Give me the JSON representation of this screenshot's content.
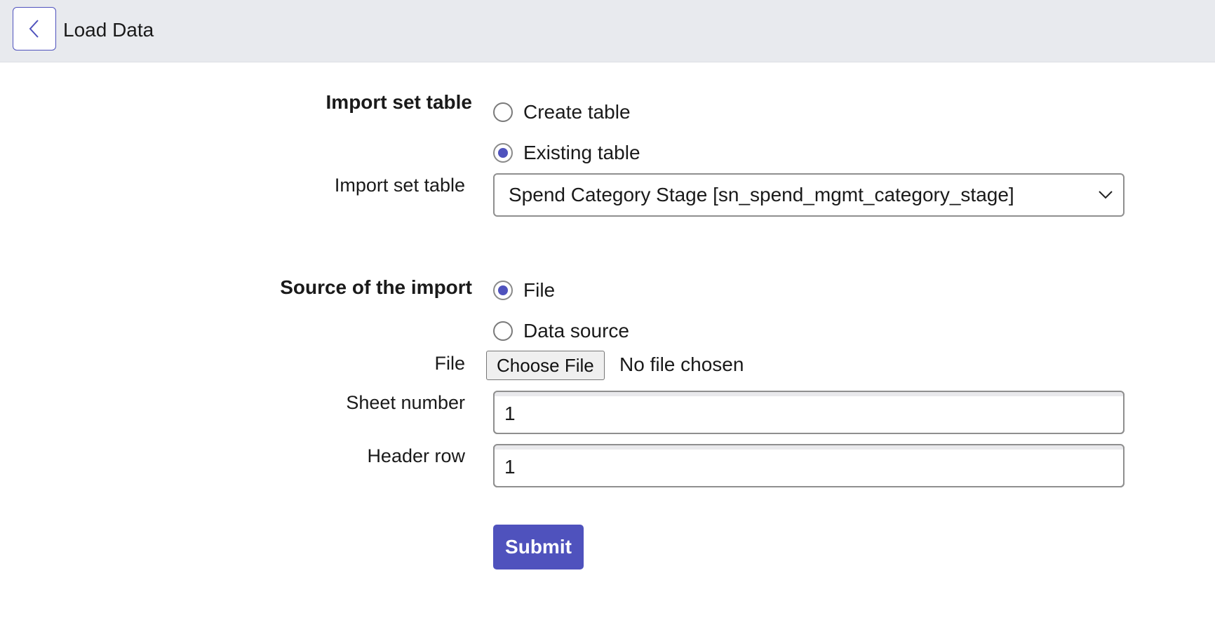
{
  "header": {
    "title": "Load Data",
    "back_icon": "chevron-left-icon"
  },
  "import_set_table_group": {
    "label": "Import set table",
    "options": [
      {
        "label": "Create table",
        "selected": false
      },
      {
        "label": "Existing table",
        "selected": true
      }
    ]
  },
  "import_set_table_select": {
    "label": "Import set table",
    "value": "Spend Category Stage [sn_spend_mgmt_category_stage]"
  },
  "source_group": {
    "label": "Source of the import",
    "options": [
      {
        "label": "File",
        "selected": true
      },
      {
        "label": "Data source",
        "selected": false
      }
    ]
  },
  "file_field": {
    "label": "File",
    "button_label": "Choose File",
    "status": "No file chosen"
  },
  "sheet_number": {
    "label": "Sheet number",
    "value": "1"
  },
  "header_row": {
    "label": "Header row",
    "value": "1"
  },
  "submit": {
    "label": "Submit"
  },
  "colors": {
    "accent": "#4f52bd",
    "header_bg": "#e8eaee"
  }
}
